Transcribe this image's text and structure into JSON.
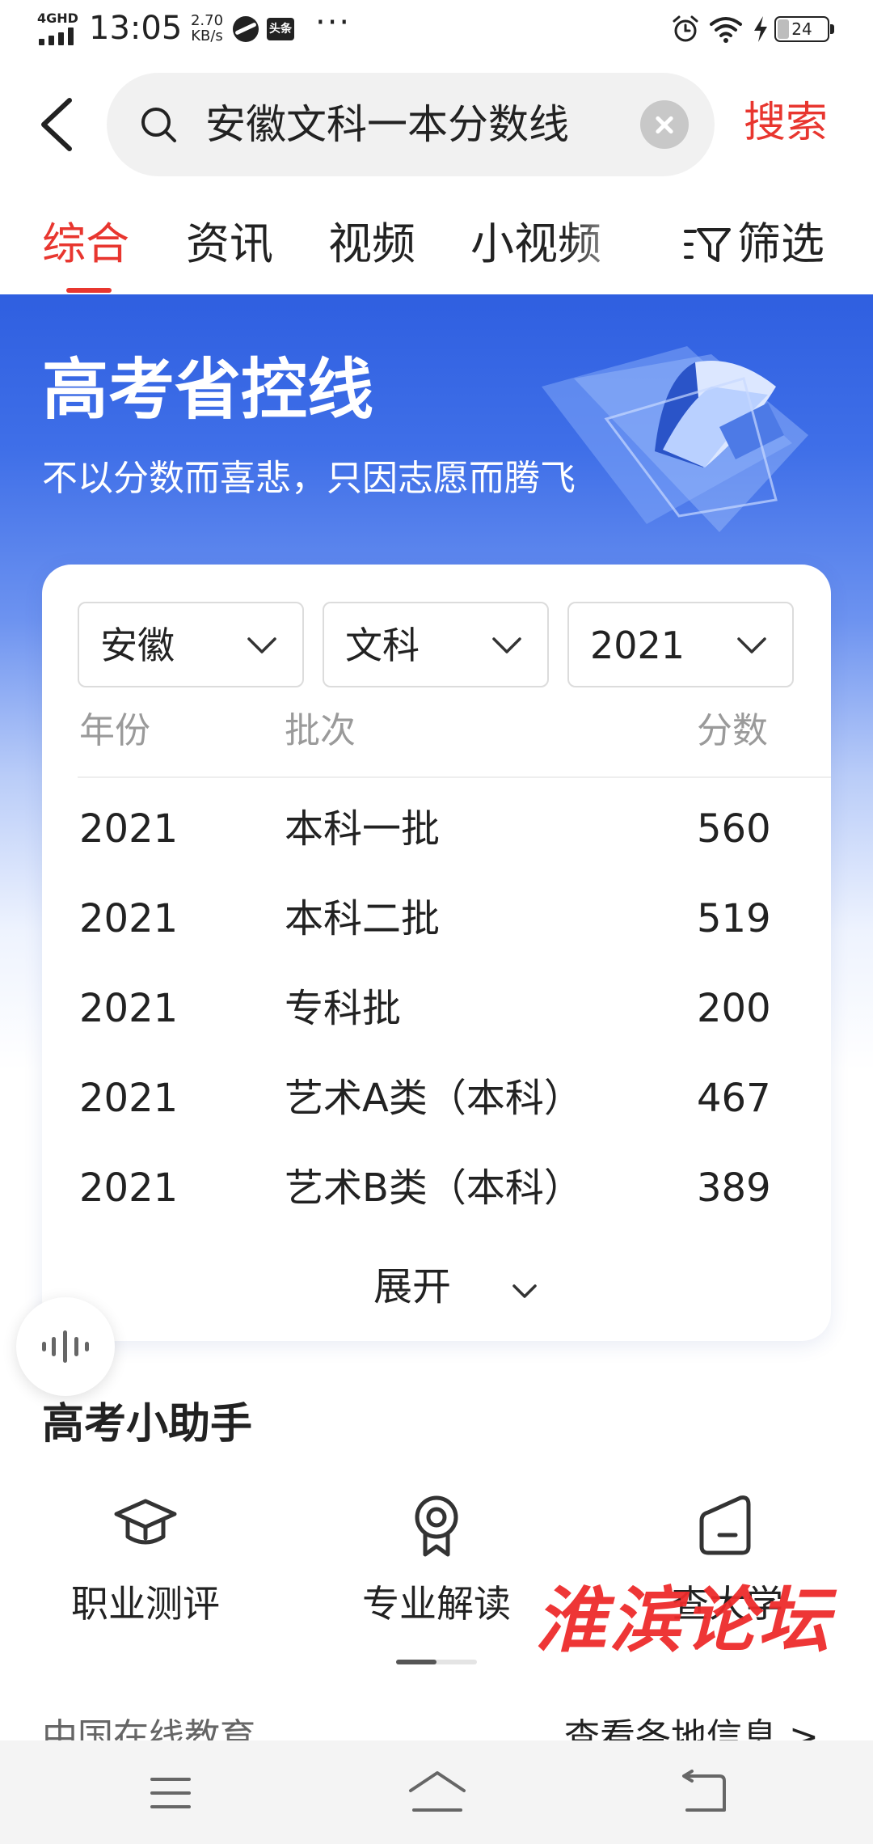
{
  "status_bar": {
    "network": "4GHD",
    "time": "13:05",
    "speed_value": "2.70",
    "speed_unit": "KB/s",
    "toutiao_badge": "头条",
    "more": "···",
    "battery": "24",
    "battery_fraction": 0.24
  },
  "search": {
    "query": "安徽文科一本分数线",
    "button_label": "搜索"
  },
  "tabs": {
    "items": [
      "综合",
      "资讯",
      "视频",
      "小视频"
    ],
    "active_index": 0,
    "filter_label": "筛选"
  },
  "banner": {
    "title": "高考省控线",
    "subtitle": "不以分数而喜悲，只因志愿而腾飞"
  },
  "score_card": {
    "selectors": {
      "province": "安徽",
      "subject": "文科",
      "year": "2021"
    },
    "headers": {
      "year": "年份",
      "batch": "批次",
      "score": "分数"
    },
    "rows": [
      {
        "year": "2021",
        "batch": "本科一批",
        "score": "560"
      },
      {
        "year": "2021",
        "batch": "本科二批",
        "score": "519"
      },
      {
        "year": "2021",
        "batch": "专科批",
        "score": "200"
      },
      {
        "year": "2021",
        "batch": "艺术A类（本科）",
        "score": "467"
      },
      {
        "year": "2021",
        "batch": "艺术B类（本科）",
        "score": "389"
      }
    ],
    "expand_label": "展开"
  },
  "helper": {
    "title": "高考小助手",
    "items": [
      {
        "label": "职业测评",
        "icon": "graduation-cap-icon"
      },
      {
        "label": "专业解读",
        "icon": "award-badge-icon"
      },
      {
        "label": "查大学",
        "icon": "building-icon"
      }
    ]
  },
  "watermark": "淮滨论坛",
  "footer_peek": {
    "source": "中国在线教育",
    "link": "查看各地信息 >"
  },
  "colors": {
    "accent": "#e8362f",
    "banner_blue": "#2f5fe0"
  }
}
